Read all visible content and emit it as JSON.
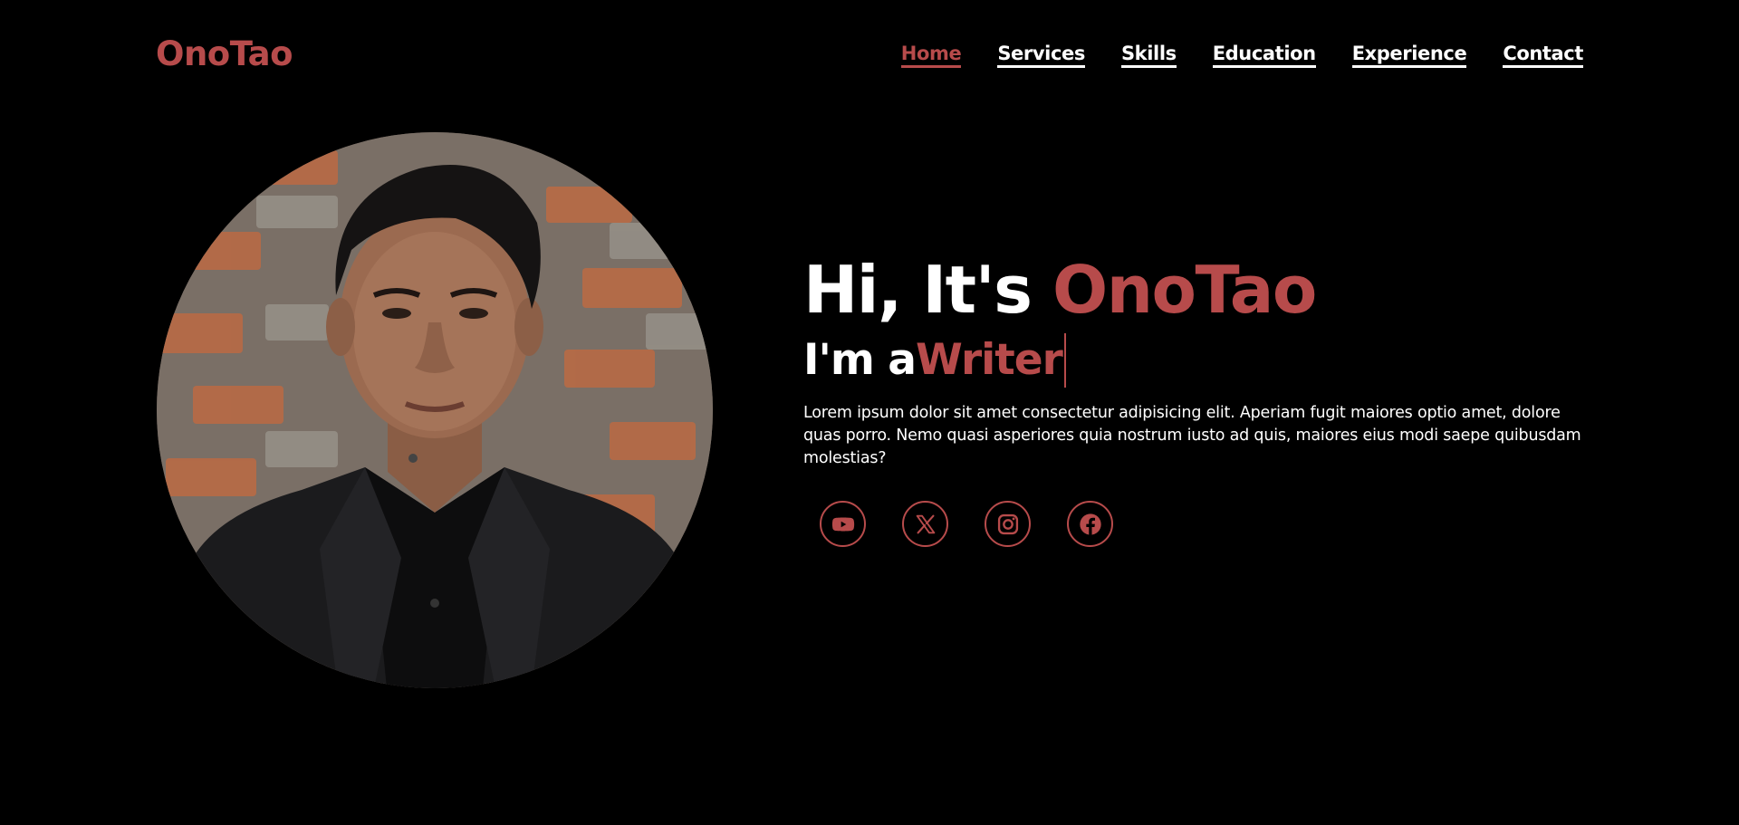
{
  "header": {
    "logo": "OnoTao",
    "nav": [
      {
        "label": "Home",
        "active": true
      },
      {
        "label": "Services",
        "active": false
      },
      {
        "label": "Skills",
        "active": false
      },
      {
        "label": "Education",
        "active": false
      },
      {
        "label": "Experience",
        "active": false
      },
      {
        "label": "Contact",
        "active": false
      }
    ]
  },
  "hero": {
    "greeting": "Hi, It's",
    "name": "OnoTao",
    "role_prefix": "I'm a",
    "role": "Writer",
    "description": "Lorem ipsum dolor sit amet consectetur adipisicing elit. Aperiam fugit maiores optio amet, dolore quas porro. Nemo quasi asperiores quia nostrum iusto ad quis, maiores eius modi saepe quibusdam molestias?"
  },
  "social": [
    {
      "name": "youtube",
      "icon": "youtube-icon"
    },
    {
      "name": "x",
      "icon": "x-icon"
    },
    {
      "name": "instagram",
      "icon": "instagram-icon"
    },
    {
      "name": "facebook",
      "icon": "facebook-icon"
    }
  ],
  "colors": {
    "accent": "#b74b4b",
    "background": "#000000",
    "text": "#ffffff"
  }
}
